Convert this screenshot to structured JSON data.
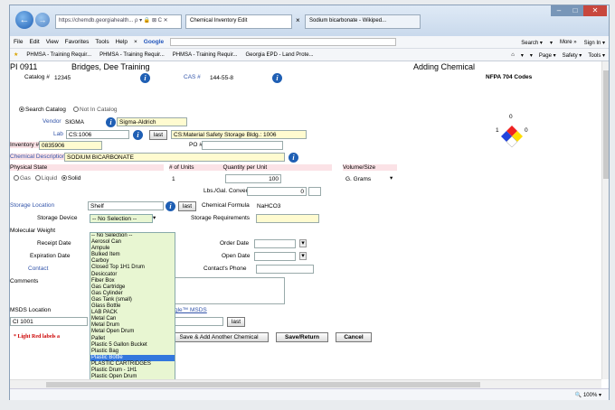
{
  "browser": {
    "back": "←",
    "forward": "→",
    "address": "https://chemdb.georgiahealth... ρ ▾ 🔒 ⊠ C ✕",
    "tabs": [
      "Chemical Inventory Edit",
      "Sodium bicarbonate - Wikiped..."
    ],
    "tab_close": "×"
  },
  "menubar": {
    "items": [
      "File",
      "Edit",
      "View",
      "Favorites",
      "Tools",
      "Help"
    ],
    "search_engine": "Google",
    "right": [
      "Search ▾",
      "▾",
      "More »",
      "Sign In ▾"
    ]
  },
  "favorites": {
    "items": [
      "PHMSA - Training Requir...",
      "PHMSA - Training Requir...",
      "PHMSA - Training Requir...",
      "Georgia EPD - Land Prote..."
    ],
    "right": [
      "▾",
      "▾",
      "Page ▾",
      "Safety ▾",
      "Tools ▾"
    ]
  },
  "page": {
    "header_left": "PI 0911",
    "header_name": "Bridges, Dee Training",
    "header_right": "Adding Chemical",
    "catalog_label": "Catalog #",
    "catalog_value": "12345",
    "cas_label": "CAS #",
    "cas_value": "144-55-8",
    "nfpa_label": "NFPA 704 Codes",
    "nfpa_values": {
      "health": "1",
      "fire": "0",
      "reactivity": "0"
    },
    "search_catalog": "Search Catalog",
    "not_in_catalog": "Not In Catalog",
    "vendor_label": "Vendor",
    "vendor_code": "SIGMA",
    "vendor_name": "Sigma-Aldrich",
    "lab_label": "Lab",
    "lab_value": "CS:1006",
    "lab_desc": "CS:Material Safety Storage Bldg.: 1006",
    "inventory_label": "Inventory #",
    "inventory_value": "0835906",
    "po_label": "PO #",
    "chem_desc_label": "Chemical Description",
    "chem_desc_value": "SODIUM BICARBONATE",
    "physical_state_label": "Physical State",
    "gas": "Gas",
    "liquid": "Liquid",
    "solid": "Solid",
    "units_label": "# of Units",
    "units_value": "1",
    "qty_label": "Quantity per Unit",
    "qty_value": "100",
    "volume_label": "Volume/Size",
    "volume_value": "G. Grams",
    "lbs_label": "Lbs./Gal. Convert",
    "lbs_value": "0",
    "storage_loc_label": "Storage Location",
    "storage_loc_value": "Shelf",
    "chem_formula_label": "Chemical Formula",
    "chem_formula_value": "NaHCO3",
    "storage_device_label": "Storage Device",
    "storage_device_value": "-- No Selection --",
    "storage_req_label": "Storage Requirements",
    "mol_weight_label": "Molecular Weight",
    "receipt_label": "Receipt Date",
    "order_label": "Order Date",
    "expiration_label": "Expiration Date",
    "open_label": "Open Date",
    "contact_label": "Contact",
    "contact_phone_label": "Contact's Phone",
    "comments_label": "Comments",
    "msds_label": "MSDS Location",
    "msds_value": "CI 1001",
    "google_msds": "gle™ MSDS",
    "light_red_note": "* Light Red labels a",
    "last": "last",
    "save_add": "Save & Add Another Chemical",
    "save_return": "Save/Return",
    "cancel": "Cancel"
  },
  "dropdown": {
    "options": [
      "-- No Selection --",
      "Aerosol Can",
      "Ampule",
      "Bulked Item",
      "Carboy",
      "Closed Top 1H1 Drum",
      "Desiccator",
      "Fiber Box",
      "Gas Cartridge",
      "Gas Cylinder",
      "Gas Tank (small)",
      "Glass Bottle",
      "LAB PACK",
      "Metal Can",
      "Metal Drum",
      "Metal Open Drum",
      "Pallet",
      "Plastic 5 Gallon Bucket",
      "Plastic Bag",
      "Plastic Bottle",
      "PLASTIC CARTRIDGES",
      "Plastic Drum - 1H1",
      "Plastic Open Drum"
    ],
    "highlighted_index": 19
  },
  "status": {
    "zoom": "100%"
  }
}
